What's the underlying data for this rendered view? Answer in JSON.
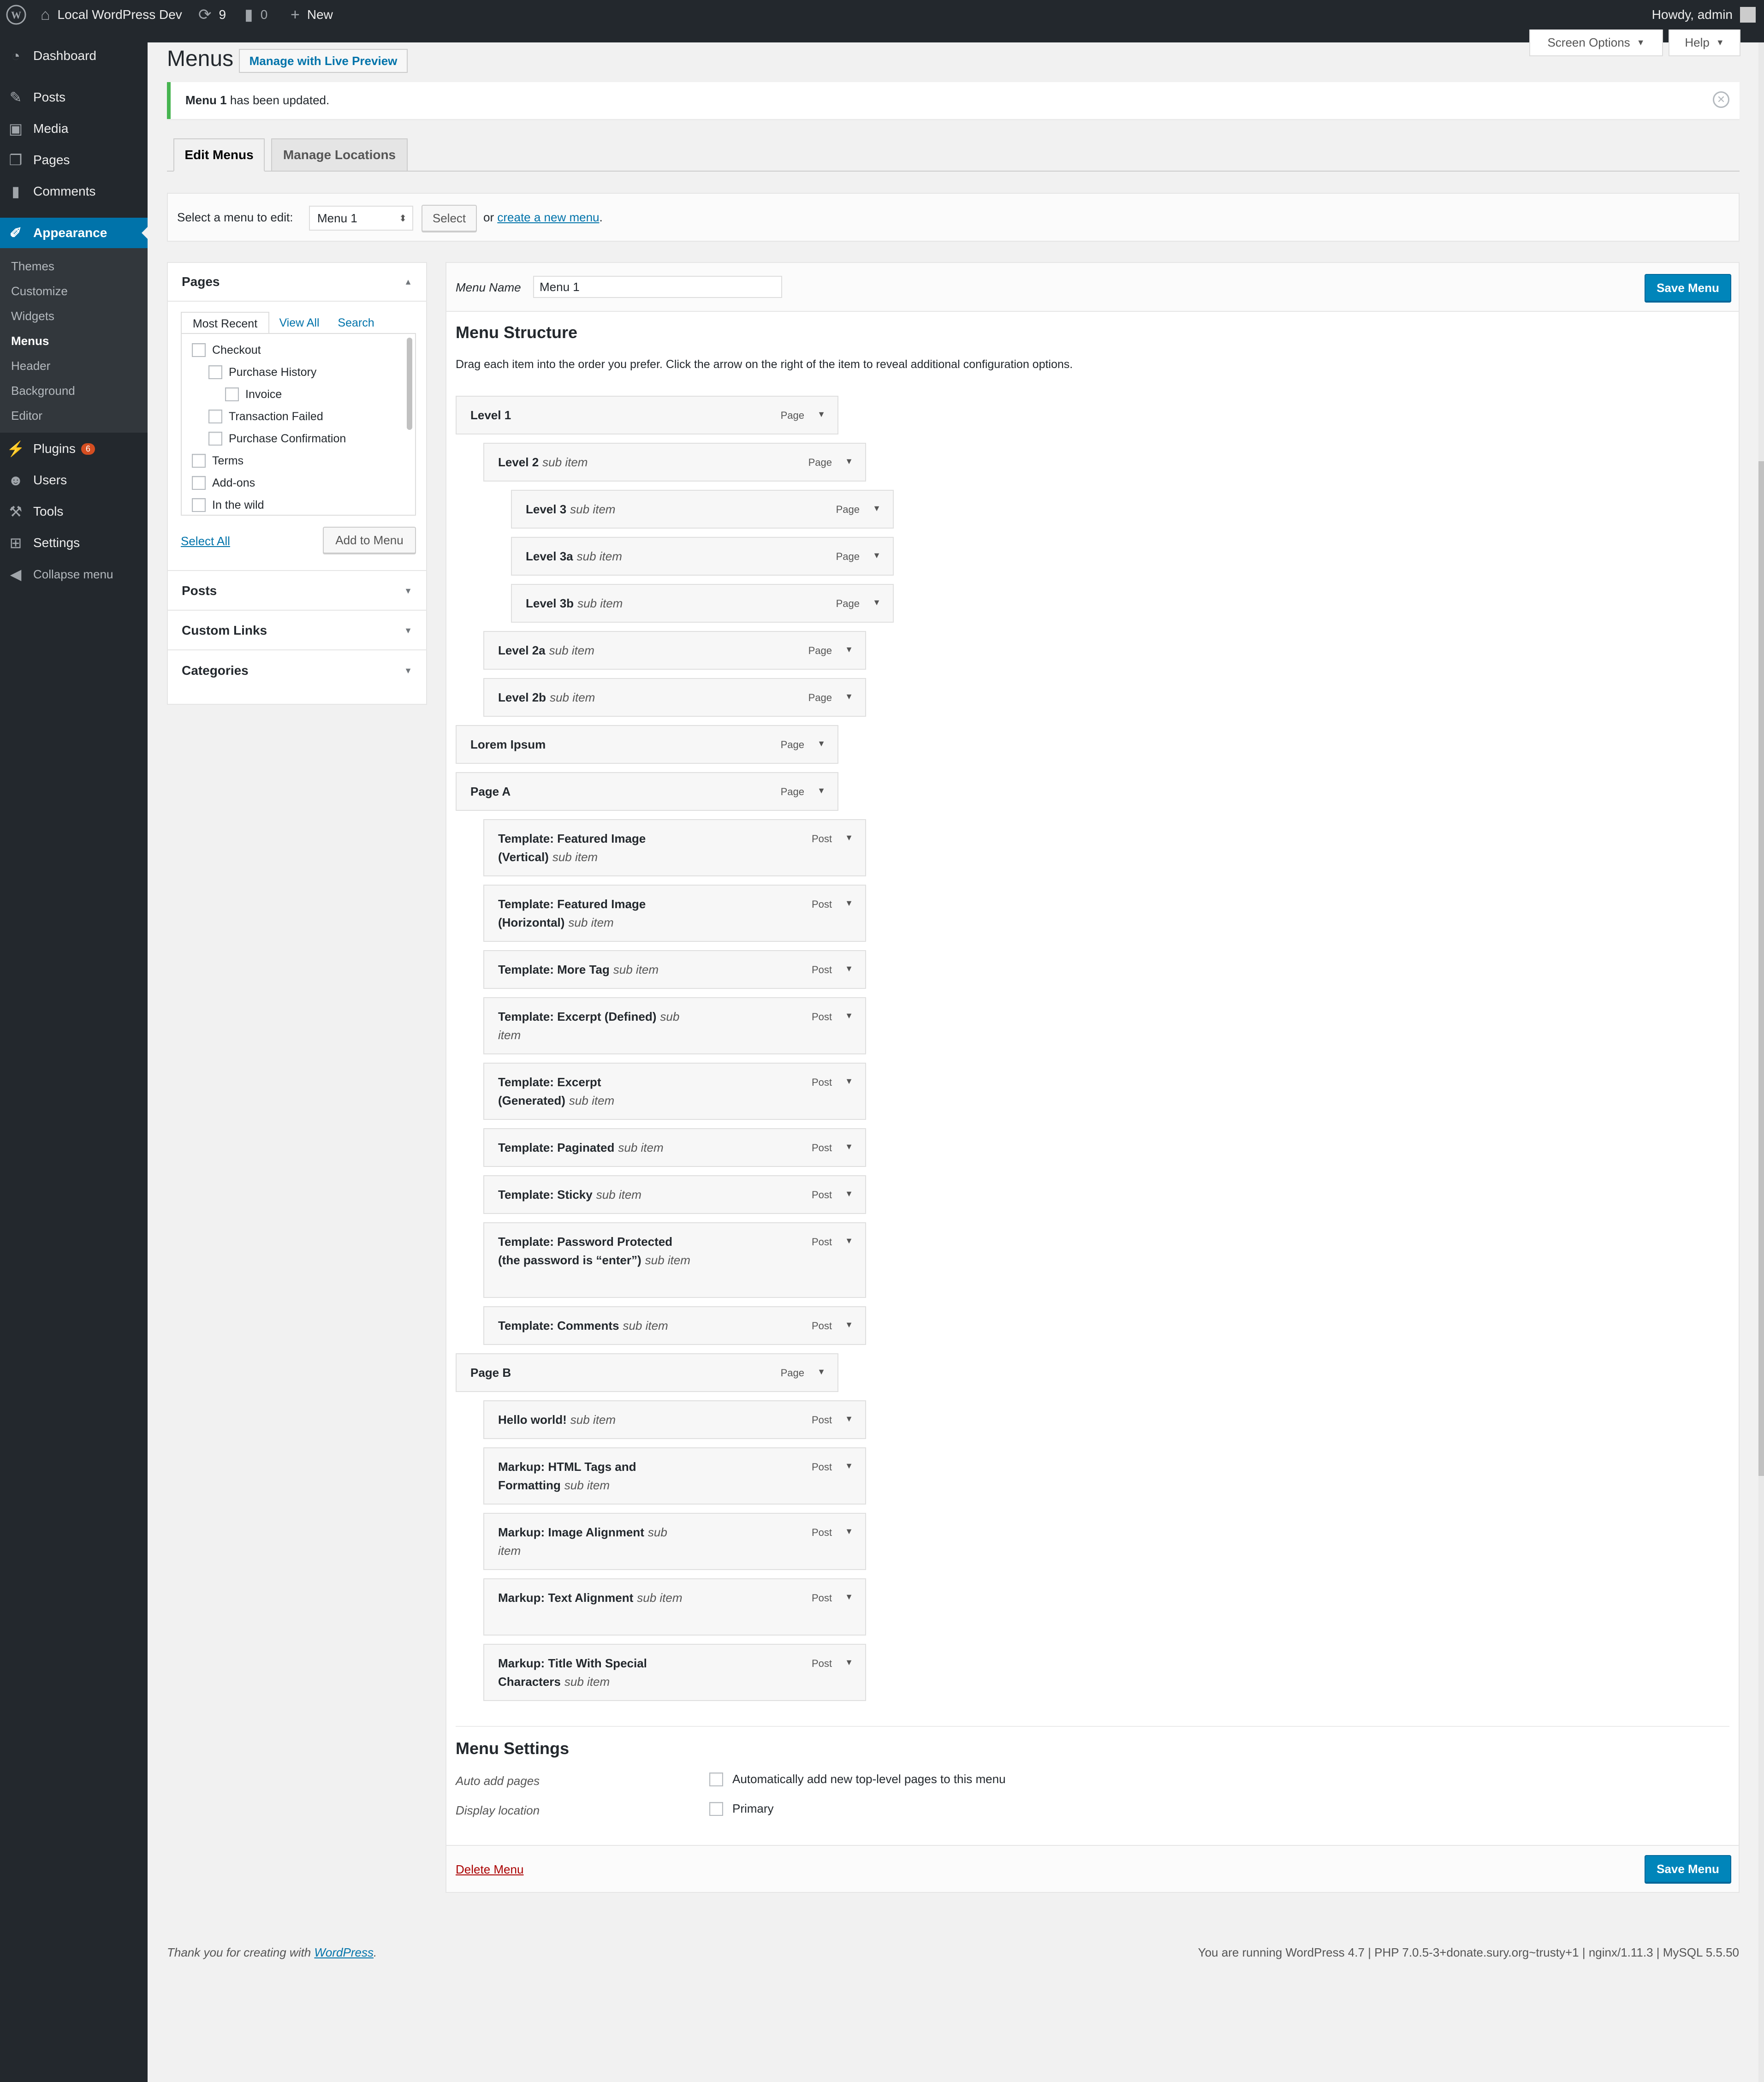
{
  "admin_bar": {
    "site_name": "Local WordPress Dev",
    "updates_count": "9",
    "comments_count": "0",
    "new_label": "New",
    "howdy": "Howdy, admin"
  },
  "sidebar": {
    "items": [
      {
        "label": "Dashboard",
        "icon": "dashboard-icon"
      },
      {
        "label": "Posts",
        "icon": "pin-icon"
      },
      {
        "label": "Media",
        "icon": "media-icon"
      },
      {
        "label": "Pages",
        "icon": "pages-icon"
      },
      {
        "label": "Comments",
        "icon": "comment-icon"
      },
      {
        "label": "Appearance",
        "icon": "brush-icon"
      },
      {
        "label": "Plugins",
        "icon": "plug-icon",
        "badge": "6"
      },
      {
        "label": "Users",
        "icon": "users-icon"
      },
      {
        "label": "Tools",
        "icon": "wrench-icon"
      },
      {
        "label": "Settings",
        "icon": "settings-icon"
      },
      {
        "label": "Collapse menu",
        "icon": "collapse-icon"
      }
    ],
    "submenu": [
      "Themes",
      "Customize",
      "Widgets",
      "Menus",
      "Header",
      "Background",
      "Editor"
    ],
    "current_submenu": "Menus"
  },
  "header": {
    "title": "Menus",
    "live_preview": "Manage with Live Preview",
    "screen_options": "Screen Options",
    "help": "Help"
  },
  "notice": {
    "menu_name": "Menu 1",
    "text": "has been updated."
  },
  "tabs": {
    "edit": "Edit Menus",
    "locations": "Manage Locations"
  },
  "select_bar": {
    "label": "Select a menu to edit:",
    "selected": "Menu 1",
    "button": "Select",
    "or": "or",
    "create_link": "create a new menu",
    "period": "."
  },
  "accordion": {
    "pages_title": "Pages",
    "tabs": [
      "Most Recent",
      "View All",
      "Search"
    ],
    "pages": [
      "Checkout",
      "Purchase History",
      "Invoice",
      "Transaction Failed",
      "Purchase Confirmation",
      "Terms",
      "Add-ons",
      "In the wild"
    ],
    "select_all": "Select All",
    "add_to_menu": "Add to Menu",
    "posts": "Posts",
    "custom_links": "Custom Links",
    "categories": "Categories"
  },
  "menu_edit": {
    "name_label": "Menu Name",
    "name_value": "Menu 1",
    "save": "Save Menu",
    "structure_title": "Menu Structure",
    "structure_desc": "Drag each item into the order you prefer. Click the arrow on the right of the item to reveal additional configuration options.",
    "sub_label": "sub item",
    "items": [
      {
        "title": "Level 1",
        "type": "Page",
        "depth": 0,
        "sub": false
      },
      {
        "title": "Level 2",
        "type": "Page",
        "depth": 1,
        "sub": true
      },
      {
        "title": "Level 3",
        "type": "Page",
        "depth": 2,
        "sub": true
      },
      {
        "title": "Level 3a",
        "type": "Page",
        "depth": 2,
        "sub": true
      },
      {
        "title": "Level 3b",
        "type": "Page",
        "depth": 2,
        "sub": true
      },
      {
        "title": "Level 2a",
        "type": "Page",
        "depth": 1,
        "sub": true
      },
      {
        "title": "Level 2b",
        "type": "Page",
        "depth": 1,
        "sub": true
      },
      {
        "title": "Lorem Ipsum",
        "type": "Page",
        "depth": 0,
        "sub": false
      },
      {
        "title": "Page A",
        "type": "Page",
        "depth": 0,
        "sub": false
      },
      {
        "title": "Template: Featured Image (Vertical)",
        "type": "Post",
        "depth": 1,
        "sub": true
      },
      {
        "title": "Template: Featured Image (Horizontal)",
        "type": "Post",
        "depth": 1,
        "sub": true
      },
      {
        "title": "Template: More Tag",
        "type": "Post",
        "depth": 1,
        "sub": true
      },
      {
        "title": "Template: Excerpt (Defined)",
        "type": "Post",
        "depth": 1,
        "sub": true
      },
      {
        "title": "Template: Excerpt (Generated)",
        "type": "Post",
        "depth": 1,
        "sub": true
      },
      {
        "title": "Template: Paginated",
        "type": "Post",
        "depth": 1,
        "sub": true
      },
      {
        "title": "Template: Sticky",
        "type": "Post",
        "depth": 1,
        "sub": true
      },
      {
        "title": "Template: Password Protected (the password is “enter”)",
        "type": "Post",
        "depth": 1,
        "sub": true
      },
      {
        "title": "Template: Comments",
        "type": "Post",
        "depth": 1,
        "sub": true
      },
      {
        "title": "Page B",
        "type": "Page",
        "depth": 0,
        "sub": false
      },
      {
        "title": "Hello world!",
        "type": "Post",
        "depth": 1,
        "sub": true
      },
      {
        "title": "Markup: HTML Tags and Formatting",
        "type": "Post",
        "depth": 1,
        "sub": true
      },
      {
        "title": "Markup: Image Alignment",
        "type": "Post",
        "depth": 1,
        "sub": true
      },
      {
        "title": "Markup: Text Alignment",
        "type": "Post",
        "depth": 1,
        "sub": true
      },
      {
        "title": "Markup: Title With Special Characters",
        "type": "Post",
        "depth": 1,
        "sub": true
      }
    ],
    "settings_title": "Menu Settings",
    "auto_add_label": "Auto add pages",
    "auto_add_option": "Automatically add new top-level pages to this menu",
    "display_label": "Display location",
    "display_option": "Primary",
    "delete": "Delete Menu"
  },
  "footer": {
    "thanks_prefix": "Thank you for creating with",
    "wordpress_link": "WordPress",
    "thanks_suffix": ".",
    "version": "You are running WordPress 4.7 | PHP 7.0.5-3+donate.sury.org~trusty+1 | nginx/1.11.3 | MySQL 5.5.50"
  }
}
